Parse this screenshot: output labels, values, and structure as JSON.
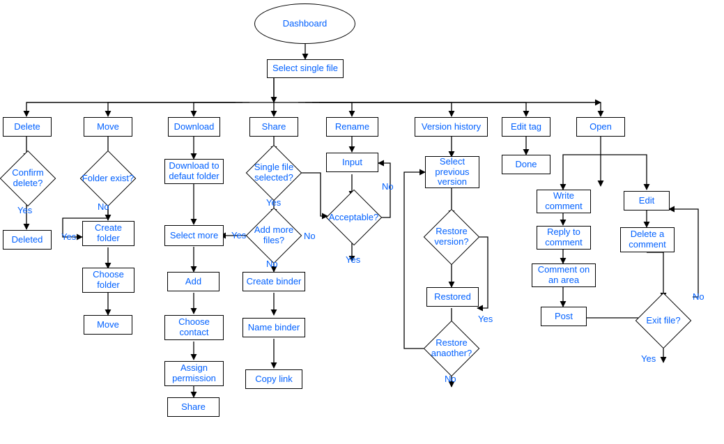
{
  "start": {
    "label": "Dashboard"
  },
  "select_file": {
    "label": "Select single file"
  },
  "actions": {
    "delete": "Delete",
    "move": "Move",
    "download": "Download",
    "share": "Share",
    "rename": "Rename",
    "version_history": "Version history",
    "edit_tag": "Edit tag",
    "open": "Open"
  },
  "delete_col": {
    "confirm": "Confirm delete?",
    "deleted": "Deleted"
  },
  "move_col": {
    "folder_exist": "Folder exist?",
    "create_folder": "Create folder",
    "choose_folder": "Choose folder",
    "move": "Move"
  },
  "download_col": {
    "download_default": "Download to defaut folder",
    "select_more": "Select more",
    "add": "Add",
    "choose_contact": "Choose contact",
    "assign_permission": "Assign permission",
    "share": "Share"
  },
  "share_col": {
    "single_selected": "Single file selected?",
    "add_more": "Add more files?",
    "create_binder": "Create binder",
    "name_binder": "Name binder",
    "copy_link": "Copy link"
  },
  "rename_col": {
    "input": "Input",
    "acceptable": "Acceptable?"
  },
  "version_col": {
    "select_previous": "Select previous version",
    "restore_version": "Restore version?",
    "restored": "Restored",
    "restore_another": "Restore anaother?"
  },
  "edit_tag_col": {
    "done": "Done"
  },
  "open_col": {
    "write_comment": "Write comment",
    "reply_comment": "Reply to comment",
    "comment_area": "Comment on an area",
    "post": "Post",
    "edit": "Edit",
    "delete_comment": "Delete a comment",
    "exit_file": "Exit file?"
  },
  "labels": {
    "yes": "Yes",
    "no": "No"
  }
}
